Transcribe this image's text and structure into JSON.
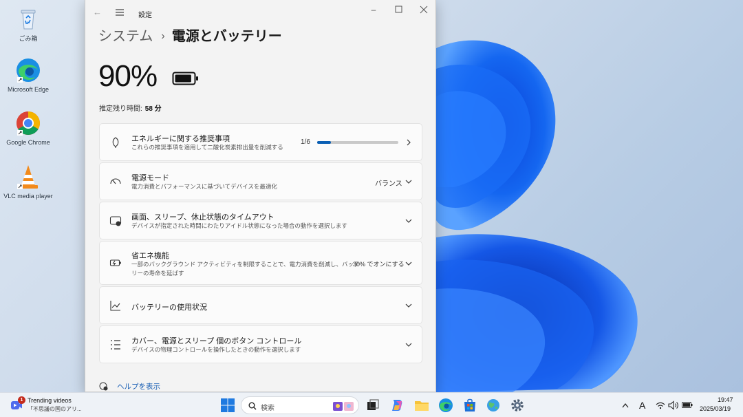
{
  "desktop": {
    "icons": [
      {
        "label": "ごみ箱"
      },
      {
        "label": "Microsoft Edge"
      },
      {
        "label": "Google Chrome"
      },
      {
        "label": "VLC media player"
      }
    ]
  },
  "window": {
    "title": "設定",
    "breadcrumb_parent": "システム",
    "breadcrumb_sep": "›",
    "breadcrumb_current": "電源とバッテリー",
    "battery_percent": "90%",
    "battery_level": 0.9,
    "remaining_label": "推定残り時間:",
    "remaining_value": "58 分",
    "cards": [
      {
        "title": "エネルギーに関する推奨事項",
        "desc": "これらの推奨事項を適用して二酸化炭素排出量を削減する",
        "value": "1/6",
        "progress": 0.1667,
        "icon": "leaf-icon"
      },
      {
        "title": "電源モード",
        "desc": "電力消費とパフォーマンスに基づいてデバイスを最適化",
        "value": "バランス",
        "icon": "power-mode-icon"
      },
      {
        "title": "画面、スリープ、休止状態のタイムアウト",
        "desc": "デバイスが指定された時間にわたりアイドル状態になった場合の動作を選択します",
        "icon": "screen-sleep-icon"
      },
      {
        "title": "省エネ機能",
        "desc_line1": "一部のバックグラウンド アクティビティを制限することで、電力消費を削減し、バッテ",
        "desc_line2": "リーの寿命を延ばす",
        "value": "30% でオンにする",
        "icon": "energy-saver-icon"
      },
      {
        "title": "バッテリーの使用状況",
        "icon": "chart-icon"
      },
      {
        "title": "カバー、電源とスリープ 個のボタン コントロール",
        "desc": "デバイスの物理コントロールを操作したときの動作を選択します",
        "icon": "list-icon"
      }
    ],
    "help_label": "ヘルプを表示"
  },
  "taskbar": {
    "widget_title": "Trending videos",
    "widget_sub": "「不思議の国のアリ...",
    "widget_badge": "1",
    "search_placeholder": "検索",
    "ime_label": "A",
    "time": "19:47",
    "date": "2025/03/19"
  },
  "colors": {
    "accent": "#0a5fb4",
    "window_bg": "#f3f3f3",
    "card_bg": "#fbfbfb",
    "taskbar_bg": "#eef2f7",
    "badge": "#c42b1c"
  }
}
